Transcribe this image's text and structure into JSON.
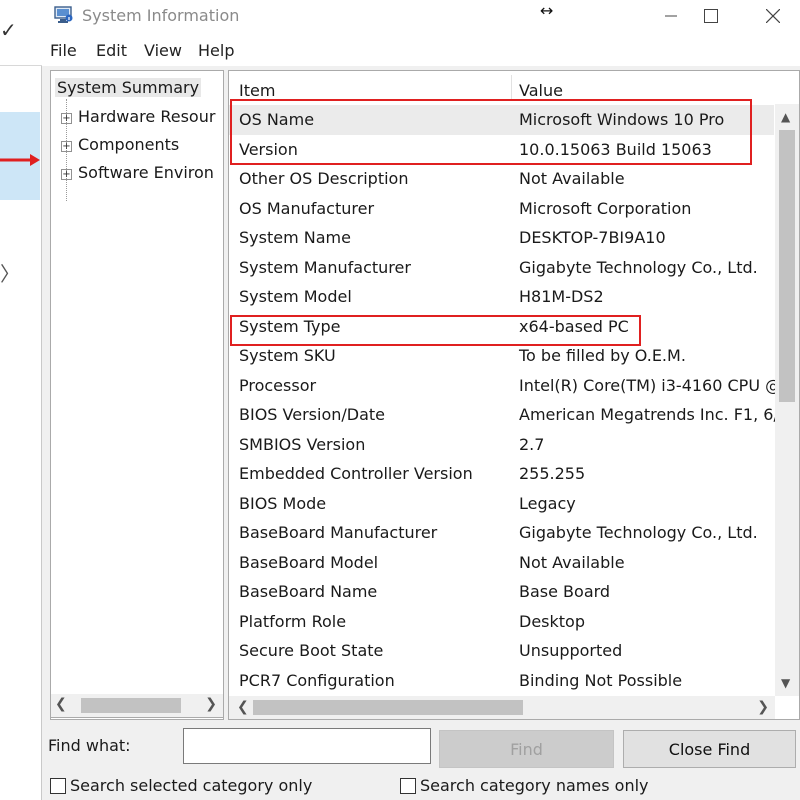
{
  "window": {
    "title": "System Information",
    "icon": "system-information-icon",
    "menu": [
      "File",
      "Edit",
      "View",
      "Help"
    ]
  },
  "tree": {
    "root": "System Summary",
    "nodes": [
      "Hardware Resour",
      "Components",
      "Software Environ"
    ]
  },
  "list": {
    "headers": {
      "item": "Item",
      "value": "Value"
    },
    "rows": [
      {
        "item": "OS Name",
        "value": "Microsoft Windows 10 Pro"
      },
      {
        "item": "Version",
        "value": "10.0.15063 Build 15063"
      },
      {
        "item": "Other OS Description",
        "value": "Not Available"
      },
      {
        "item": "OS Manufacturer",
        "value": "Microsoft Corporation"
      },
      {
        "item": "System Name",
        "value": "DESKTOP-7BI9A10"
      },
      {
        "item": "System Manufacturer",
        "value": "Gigabyte Technology Co., Ltd."
      },
      {
        "item": "System Model",
        "value": "H81M-DS2"
      },
      {
        "item": "System Type",
        "value": "x64-based PC"
      },
      {
        "item": "System SKU",
        "value": "To be filled by O.E.M."
      },
      {
        "item": "Processor",
        "value": "Intel(R) Core(TM) i3-4160 CPU @"
      },
      {
        "item": "BIOS Version/Date",
        "value": "American Megatrends Inc. F1, 6/"
      },
      {
        "item": "SMBIOS Version",
        "value": "2.7"
      },
      {
        "item": "Embedded Controller Version",
        "value": "255.255"
      },
      {
        "item": "BIOS Mode",
        "value": "Legacy"
      },
      {
        "item": "BaseBoard Manufacturer",
        "value": "Gigabyte Technology Co., Ltd."
      },
      {
        "item": "BaseBoard Model",
        "value": "Not Available"
      },
      {
        "item": "BaseBoard Name",
        "value": "Base Board"
      },
      {
        "item": "Platform Role",
        "value": "Desktop"
      },
      {
        "item": "Secure Boot State",
        "value": "Unsupported"
      },
      {
        "item": "PCR7 Configuration",
        "value": "Binding Not Possible"
      }
    ],
    "selected_row": "OS Name"
  },
  "find": {
    "label": "Find what:",
    "value": "",
    "find_button": "Find",
    "close_find_button": "Close Find",
    "search_selected_label": "Search selected category only",
    "search_names_label": "Search category names only"
  },
  "colors": {
    "annotation": "#e02020",
    "selection": "#ebebeb",
    "background_panel": "#cde6f7"
  }
}
